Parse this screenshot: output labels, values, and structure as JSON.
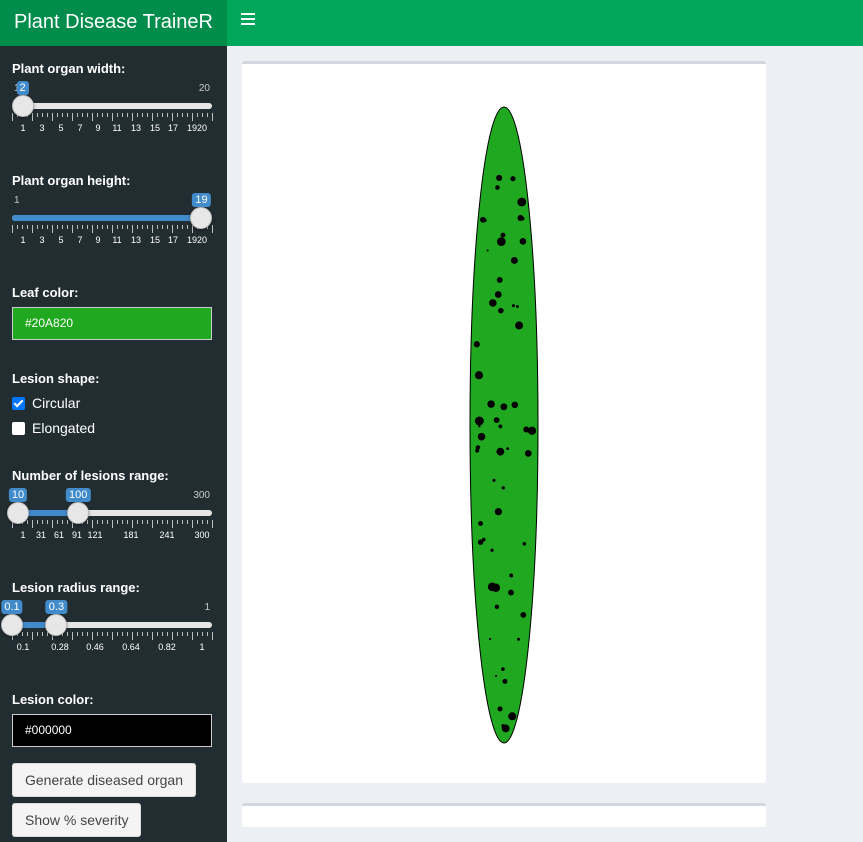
{
  "app": {
    "title": "Plant Disease TraineR"
  },
  "header": {
    "menu_icon": "hamburger-icon"
  },
  "sidebar": {
    "organ_width": {
      "label": "Plant organ width:",
      "min": "1",
      "max": "20",
      "value": "2",
      "value_num": 2,
      "ticks": [
        "1",
        "3",
        "5",
        "7",
        "9",
        "11",
        "13",
        "15",
        "17",
        "1920"
      ]
    },
    "organ_height": {
      "label": "Plant organ height:",
      "min": "1",
      "max": "",
      "value": "19",
      "value_num": 19,
      "ticks": [
        "1",
        "3",
        "5",
        "7",
        "9",
        "11",
        "13",
        "15",
        "17",
        "1920"
      ]
    },
    "leaf_color": {
      "label": "Leaf color:",
      "value": "#20A820",
      "swatch": "#20A820"
    },
    "lesion_shape": {
      "label": "Lesion shape:",
      "options": [
        "Circular",
        "Elongated"
      ],
      "checked": [
        true,
        false
      ]
    },
    "num_lesions": {
      "label": "Number of lesions range:",
      "min": "",
      "max": "300",
      "low": "10",
      "high": "100",
      "low_num": 10,
      "high_num": 100,
      "ticks": [
        "1",
        "31",
        "61",
        "91",
        "121",
        "181",
        "241",
        "300"
      ]
    },
    "lesion_radius": {
      "label": "Lesion radius range:",
      "min": "",
      "max": "1",
      "low": "0.1",
      "high": "0.3",
      "low_num": 0.1,
      "high_num": 0.3,
      "ticks": [
        "0.1",
        "0.28",
        "0.46",
        "0.64",
        "0.82",
        "1"
      ]
    },
    "lesion_color": {
      "label": "Lesion color:",
      "value": "#000000",
      "swatch": "#000000"
    },
    "generate_button": "Generate diseased organ",
    "severity_button": "Show % severity"
  },
  "colors": {
    "header": "#00a65a",
    "logo": "#008d4c",
    "sidebar": "#222d32",
    "accent": "#428bca",
    "leaf": "#20A820",
    "lesion": "#000000"
  }
}
